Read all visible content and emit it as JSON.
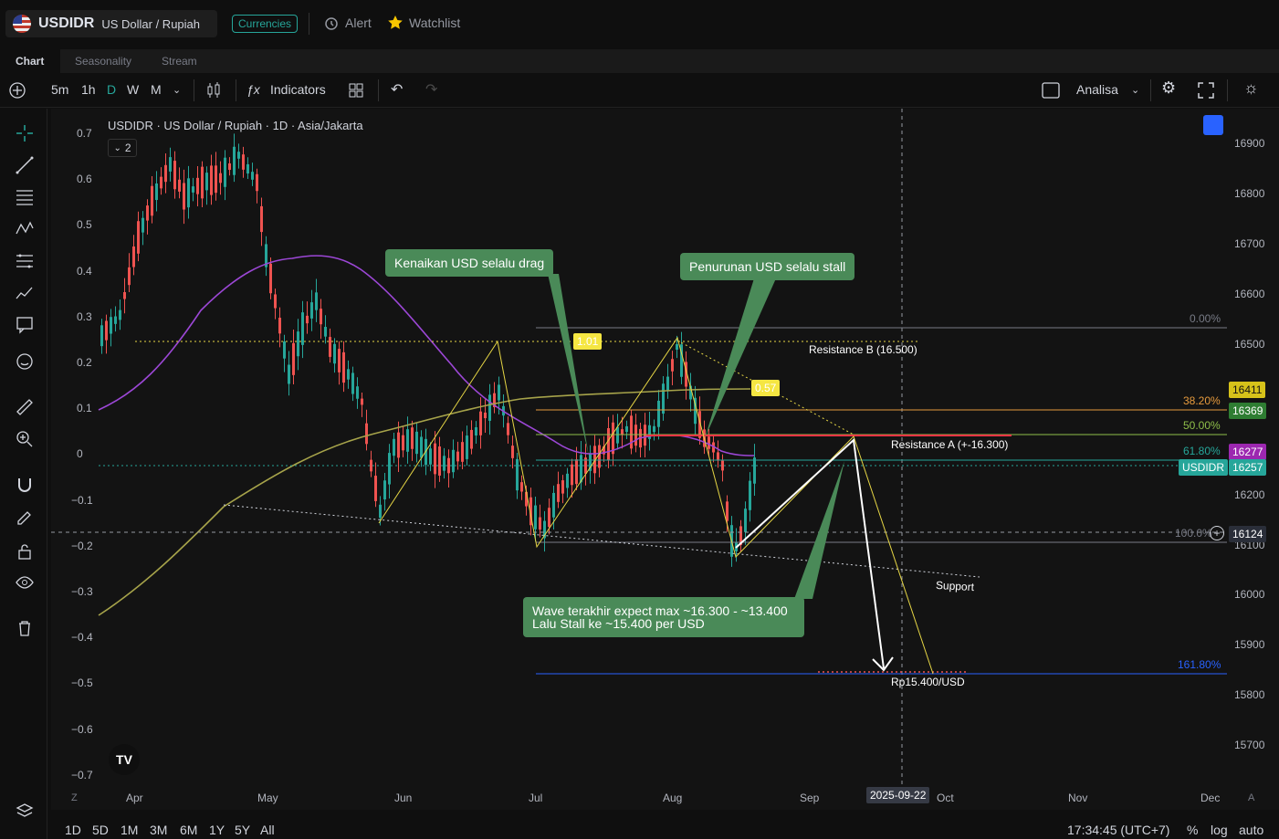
{
  "header": {
    "symbol": "USDIDR",
    "symbol_name": "US Dollar / Rupiah",
    "category_badge": "Currencies",
    "alert_label": "Alert",
    "watchlist_label": "Watchlist"
  },
  "tabs": [
    "Chart",
    "Seasonality",
    "Stream"
  ],
  "toolbar": {
    "intervals": [
      "5m",
      "1h",
      "D",
      "W",
      "M"
    ],
    "active_interval": "D",
    "indicators_label": "Indicators",
    "layout_label": "Analisa"
  },
  "legend": {
    "title": "USDIDR · US Dollar / Rupiah · 1D · Asia/Jakarta",
    "count": "2"
  },
  "left_scale": [
    "0.7",
    "0.6",
    "0.5",
    "0.4",
    "0.3",
    "0.2",
    "0.1",
    "0",
    "−0.1",
    "−0.2",
    "−0.3",
    "−0.4",
    "−0.5",
    "−0.6",
    "−0.7"
  ],
  "right_scale": [
    "16900",
    "16800",
    "16700",
    "16600",
    "16500",
    "16200",
    "16100",
    "16000",
    "15900",
    "15800",
    "15700"
  ],
  "time_axis": [
    "Apr",
    "May",
    "Jun",
    "Jul",
    "Aug",
    "Sep",
    "Oct",
    "Nov",
    "Dec"
  ],
  "time_cursor": "2025-09-22",
  "price_tags": {
    "t16411": "16411",
    "t16369": "16369",
    "t16277": "16277",
    "sym_label": "USDIDR",
    "t16257": "16257",
    "t16124": "16124"
  },
  "fib_levels": {
    "f0": "0.00%",
    "f382": "38.20%",
    "f50": "50.00%",
    "f618": "61.80%",
    "f100": "100.0%",
    "f1618": "161.80%"
  },
  "markers": {
    "m101": "1.01",
    "m057": "0.57"
  },
  "annotations": {
    "callout1": "Kenaikan USD selalu drag",
    "callout2": "Penurunan USD selalu stall",
    "callout3_line1": "Wave terakhir expect max ~16.300 - ~13.400",
    "callout3_line2": "Lalu Stall ke ~15.400 per USD",
    "resistance_b": "Resistance B (16.500)",
    "resistance_a": "Resistance A (+-16.300)",
    "support": "Support",
    "target": "Rp15.400/USD"
  },
  "bottom": {
    "ranges": [
      "1D",
      "5D",
      "1M",
      "3M",
      "6M",
      "1Y",
      "5Y",
      "All"
    ],
    "clock": "17:34:45 (UTC+7)",
    "pct": "%",
    "log": "log",
    "auto": "auto"
  },
  "colors": {
    "bull": "#26a69a",
    "bear": "#ef5350",
    "ma_purple": "#9c47d6",
    "ma_olive": "#a6a34a",
    "fib_yellow": "#e6d645",
    "callout_green": "#4a8a58",
    "resistance_red": "#f23645"
  }
}
